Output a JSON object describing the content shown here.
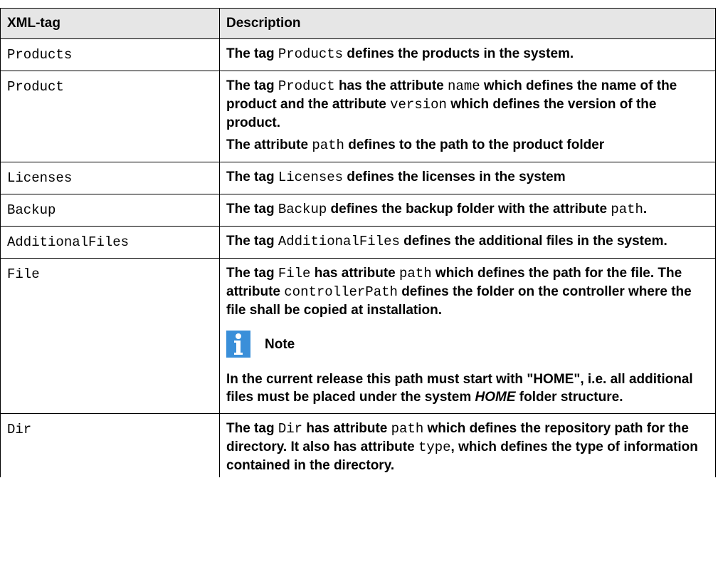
{
  "table": {
    "headers": [
      "XML-tag",
      "Description"
    ],
    "rows": [
      {
        "tag": "Products",
        "desc": [
          [
            [
              "t",
              "The tag "
            ],
            [
              "c",
              "Products"
            ],
            [
              "t",
              " defines the products in the system."
            ]
          ]
        ]
      },
      {
        "tag": "Product",
        "desc": [
          [
            [
              "t",
              "The tag "
            ],
            [
              "c",
              "Product"
            ],
            [
              "t",
              " has the attribute "
            ],
            [
              "c",
              "name"
            ],
            [
              "t",
              " which defines the name of the product and the attribute "
            ],
            [
              "c",
              "version"
            ],
            [
              "t",
              " which defines the version of the product."
            ]
          ],
          [
            [
              "t",
              "The attribute "
            ],
            [
              "c",
              "path"
            ],
            [
              "t",
              " defines to the path to the product folder"
            ]
          ]
        ]
      },
      {
        "tag": "Licenses",
        "desc": [
          [
            [
              "t",
              "The tag "
            ],
            [
              "c",
              "Licenses"
            ],
            [
              "t",
              " defines the licenses in the system"
            ]
          ]
        ]
      },
      {
        "tag": "Backup",
        "desc": [
          [
            [
              "t",
              "The tag "
            ],
            [
              "c",
              "Backup"
            ],
            [
              "t",
              " defines the backup folder with the attribute "
            ],
            [
              "c",
              "path"
            ],
            [
              "t",
              "."
            ]
          ]
        ]
      },
      {
        "tag": "AdditionalFiles",
        "desc": [
          [
            [
              "t",
              "The tag "
            ],
            [
              "c",
              "AdditionalFiles"
            ],
            [
              "t",
              " defines the additional files in the system."
            ]
          ]
        ]
      },
      {
        "tag": "File",
        "desc": [
          [
            [
              "t",
              "The tag "
            ],
            [
              "c",
              "File"
            ],
            [
              "t",
              " has attribute "
            ],
            [
              "c",
              "path"
            ],
            [
              "t",
              " which defines the path for the file. The attribute "
            ],
            [
              "c",
              "controllerPath"
            ],
            [
              "t",
              " defines the folder on the controller where the file shall be copied at installation."
            ]
          ]
        ],
        "note": {
          "icon": "info-icon",
          "label": "Note",
          "text": [
            [
              "t",
              "In the current release this path must start with \"HOME\", i.e. all additional files must be placed under the system "
            ],
            [
              "i",
              "HOME"
            ],
            [
              "t",
              " folder structure."
            ]
          ]
        }
      },
      {
        "tag": "Dir",
        "desc": [
          [
            [
              "t",
              "The tag "
            ],
            [
              "c",
              "Dir"
            ],
            [
              "t",
              " has attribute "
            ],
            [
              "c",
              "path"
            ],
            [
              "t",
              " which defines the repository path for the directory. It also has attribute "
            ],
            [
              "c",
              "type"
            ],
            [
              "t",
              ", which defines the type of information contained in the directory."
            ]
          ]
        ]
      }
    ]
  },
  "colors": {
    "header_bg": "#e6e6e6",
    "note_icon": "#3a8fd9"
  }
}
